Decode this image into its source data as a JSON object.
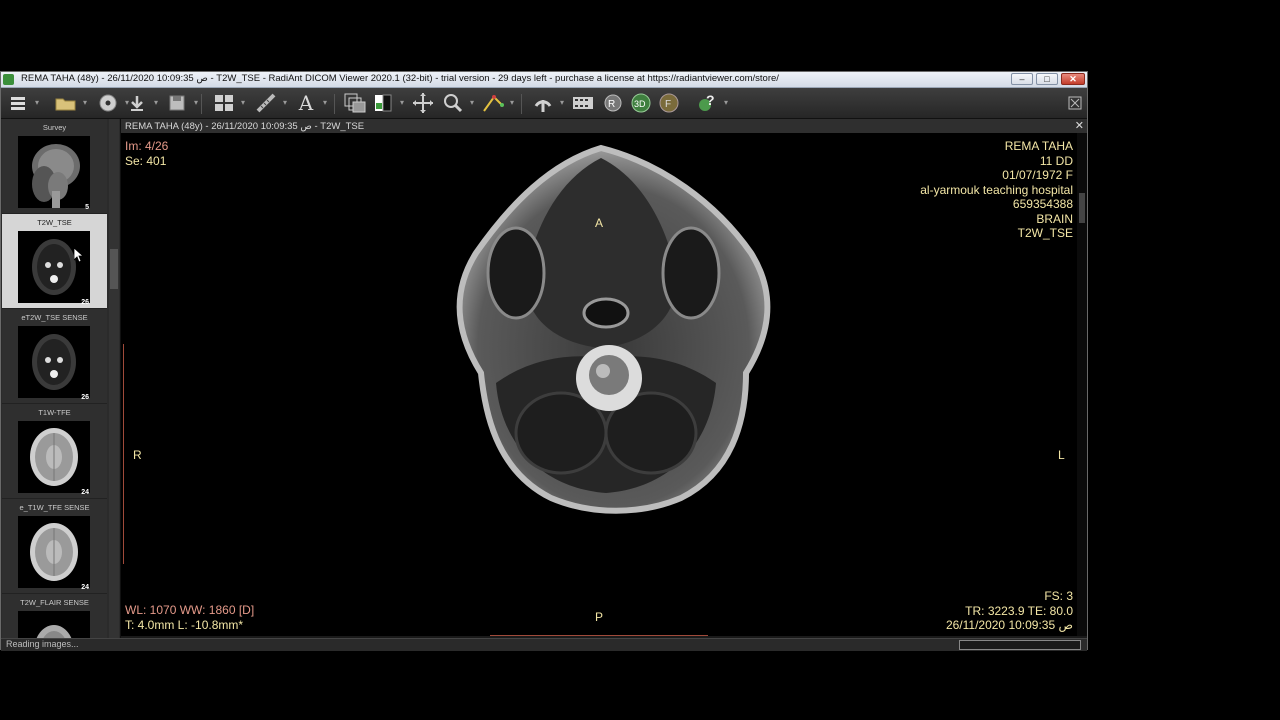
{
  "window": {
    "title": "REMA  TAHA (48y) - 26/11/2020 10:09:35 ص - T2W_TSE - RadiAnt DICOM Viewer 2020.1 (32-bit) - trial version - 29 days left - purchase a license at https://radiantviewer.com/store/",
    "minimize": "–",
    "maximize": "□",
    "close": "✕"
  },
  "toolbar": {
    "icons": [
      "menu-icon",
      "open-folder-icon",
      "cd-dvd-icon",
      "download-icon",
      "save-icon",
      "layout-grid-icon",
      "measure-icon",
      "text-annotation-icon",
      "series-stack-icon",
      "window-level-icon",
      "pan-icon",
      "zoom-icon",
      "angle-tool-icon",
      "mpr-icon",
      "cine-icon",
      "rotate-3d-icon",
      "volume-3d-icon",
      "fusion-icon",
      "help-icon",
      "fullscreen-icon"
    ],
    "text_tool_label": "A"
  },
  "sidebar": {
    "series": [
      {
        "label": "Survey",
        "count": "5"
      },
      {
        "label": "T2W_TSE",
        "count": "26"
      },
      {
        "label": "eT2W_TSE SENSE",
        "count": "26"
      },
      {
        "label": "T1W-TFE",
        "count": "24"
      },
      {
        "label": "e_T1W_TFE SENSE",
        "count": "24"
      },
      {
        "label": "T2W_FLAIR SENSE",
        "count": ""
      }
    ]
  },
  "viewer": {
    "header": "REMA  TAHA (48y) - 26/11/2020 10:09:35 ص - T2W_TSE",
    "close": "✕",
    "top_left": {
      "image": "Im: 4/26",
      "series": "Se: 401"
    },
    "top_right": {
      "name": "REMA  TAHA",
      "id_line": "11   DD",
      "dob": "01/07/1972 F",
      "hospital": "al-yarmouk teaching hospital",
      "mrn": "659354388",
      "study": "BRAIN",
      "series": "T2W_TSE"
    },
    "orientation": {
      "top": "A",
      "bottom": "P",
      "left": "R",
      "right": "L"
    },
    "bottom_left": {
      "wl": "WL: 1070 WW: 1860 [D]",
      "thickness": "T: 4.0mm L: -10.8mm*"
    },
    "bottom_right": {
      "fs": "FS: 3",
      "tr_te": "TR: 3223.9 TE: 80.0",
      "datetime": "26/11/2020 10:09:35 ص"
    }
  },
  "status": {
    "text": "Reading images...",
    "progress": 0.0
  }
}
